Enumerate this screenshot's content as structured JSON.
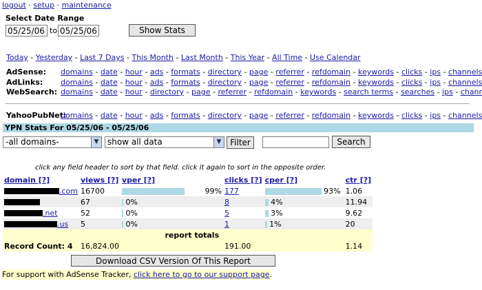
{
  "top_links": [
    "logout",
    "setup",
    "maintenance"
  ],
  "date_range": {
    "label": "Select Date Range",
    "from": "05/25/06",
    "to_word": "to",
    "to": "05/25/06",
    "button": "Show Stats"
  },
  "quick_links": [
    "Today",
    "Yesterday",
    "Last 7 Days",
    "This Month",
    "Last Month",
    "This Year",
    "All Time",
    "Use Calendar"
  ],
  "nav": {
    "adsense": {
      "label": "AdSense:",
      "items": [
        "domains",
        "date",
        "hour",
        "ads",
        "formats",
        "directory",
        "page",
        "referrer",
        "refdomain",
        "keywords",
        "clicks",
        "ips",
        "channels"
      ]
    },
    "adlinks": {
      "label": "AdLinks:",
      "items": [
        "domains",
        "date",
        "hour",
        "ads",
        "formats",
        "directory",
        "page",
        "referrer",
        "refdomain",
        "keywords",
        "clicks",
        "ips",
        "channels"
      ]
    },
    "websearch": {
      "label": "WebSearch:",
      "items": [
        "domains",
        "date",
        "hour",
        "directory",
        "page",
        "referrer",
        "refdomain",
        "keywords",
        "search terms",
        "searches",
        "ips",
        "channels"
      ]
    },
    "yahoopubnet": {
      "label": "YahooPubNet:",
      "items": [
        "domains",
        "date",
        "hour",
        "ads",
        "formats",
        "directory",
        "page",
        "referrer",
        "refdomain",
        "keywords",
        "clicks",
        "ips",
        "channels"
      ]
    }
  },
  "ypn_bar": "YPN Stats For 05/25/06 - 05/25/06",
  "filters": {
    "domain_select": "-all domains-",
    "data_select": "show all data",
    "filter_button": "Filter",
    "search_value": "",
    "search_button": "Search"
  },
  "sort_hint": "click any field header to sort by that field. click it again to sort in the opposite order.",
  "table": {
    "headers": {
      "domain": "domain [?]",
      "views": "views [?]",
      "vper": "vper [?]",
      "clicks": "clicks [?]",
      "cper": "cper [?]",
      "ctr": "ctr [?]"
    },
    "rows": [
      {
        "domain_suffix": ".com",
        "views": "16700",
        "vper": "99%",
        "vper_frac": 0.99,
        "clicks": "177",
        "cper": "93%",
        "cper_frac": 0.93,
        "ctr": "1.06"
      },
      {
        "domain_suffix": "",
        "views": "67",
        "vper": "0%",
        "vper_frac": 0.0,
        "clicks": "8",
        "cper": "4%",
        "cper_frac": 0.04,
        "ctr": "11.94"
      },
      {
        "domain_suffix": ".net",
        "views": "52",
        "vper": "0%",
        "vper_frac": 0.0,
        "clicks": "5",
        "cper": "3%",
        "cper_frac": 0.03,
        "ctr": "9.62"
      },
      {
        "domain_suffix": ".us",
        "views": "5",
        "vper": "0%",
        "vper_frac": 0.0,
        "clicks": "1",
        "cper": "1%",
        "cper_frac": 0.01,
        "ctr": "20"
      }
    ],
    "totals_label": "report totals",
    "record_count_label": "Record Count: 4",
    "total_views": "16,824.00",
    "total_clicks": "191.00",
    "total_ctr": "1.14"
  },
  "csv_button": "Download CSV Version Of This Report",
  "support": {
    "text": "For support with AdSense Tracker,",
    "link": "click here to go to our support page",
    "end": "."
  }
}
